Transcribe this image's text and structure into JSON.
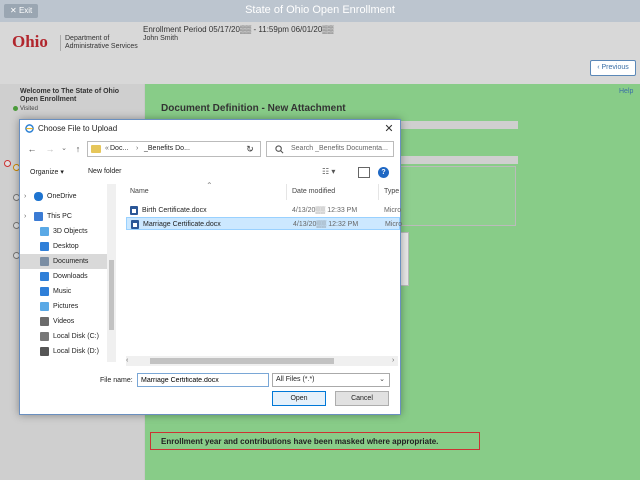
{
  "topbar": {
    "exit_label": "Exit",
    "title": "State of Ohio Open Enrollment"
  },
  "header": {
    "logo": "Ohio",
    "dept_line1": "Department of",
    "dept_line2": "Administrative Services",
    "enrollment_period": "Enrollment Period 05/17/20▒▒ - 11:59pm 06/01/20▒▒",
    "user_name": "John Smith",
    "previous_label": "Previous"
  },
  "sidebar": {
    "welcome": "Welcome to The State of Ohio Open Enrollment",
    "visited": "Visited"
  },
  "main": {
    "help": "Help",
    "doc_title": "Document Definition - New Attachment",
    "masked_notice": "Enrollment year and contributions have been masked where appropriate."
  },
  "dialog": {
    "title": "Choose File to Upload",
    "address": {
      "part1": "Doc...",
      "part2": "_Benefits Do..."
    },
    "search_placeholder": "Search _Benefits Documenta...",
    "toolbar": {
      "organize": "Organize ▾",
      "new_folder": "New folder"
    },
    "nav_items": [
      {
        "label": "OneDrive",
        "icon": "cloud-icon",
        "color": "#1e74d0"
      },
      {
        "label": "This PC",
        "icon": "pc-icon",
        "color": "#3b7bd4"
      },
      {
        "label": "3D Objects",
        "icon": "cube-icon",
        "color": "#5aa9e6"
      },
      {
        "label": "Desktop",
        "icon": "desktop-icon",
        "color": "#2f7fd8"
      },
      {
        "label": "Documents",
        "icon": "documents-icon",
        "color": "#7a8da3"
      },
      {
        "label": "Downloads",
        "icon": "download-icon",
        "color": "#2f7fd8"
      },
      {
        "label": "Music",
        "icon": "music-icon",
        "color": "#2f7fd8"
      },
      {
        "label": "Pictures",
        "icon": "pictures-icon",
        "color": "#5aa9e6"
      },
      {
        "label": "Videos",
        "icon": "video-icon",
        "color": "#6b6b6b"
      },
      {
        "label": "Local Disk (C:)",
        "icon": "disk-icon",
        "color": "#777777"
      },
      {
        "label": "Local Disk (D:)",
        "icon": "disk-icon",
        "color": "#555555"
      }
    ],
    "columns": {
      "name": "Name",
      "date": "Date modified",
      "type": "Type"
    },
    "files": [
      {
        "name": "Birth Certificate.docx",
        "date": "4/13/20▒▒ 12:33 PM",
        "type": "Micro"
      },
      {
        "name": "Marriage Certificate.docx",
        "date": "4/13/20▒▒ 12:32 PM",
        "type": "Micro"
      }
    ],
    "file_name_label": "File name:",
    "file_name_value": "Marriage Certificate.docx",
    "filter": "All Files (*.*)",
    "open_label": "Open",
    "cancel_label": "Cancel"
  }
}
